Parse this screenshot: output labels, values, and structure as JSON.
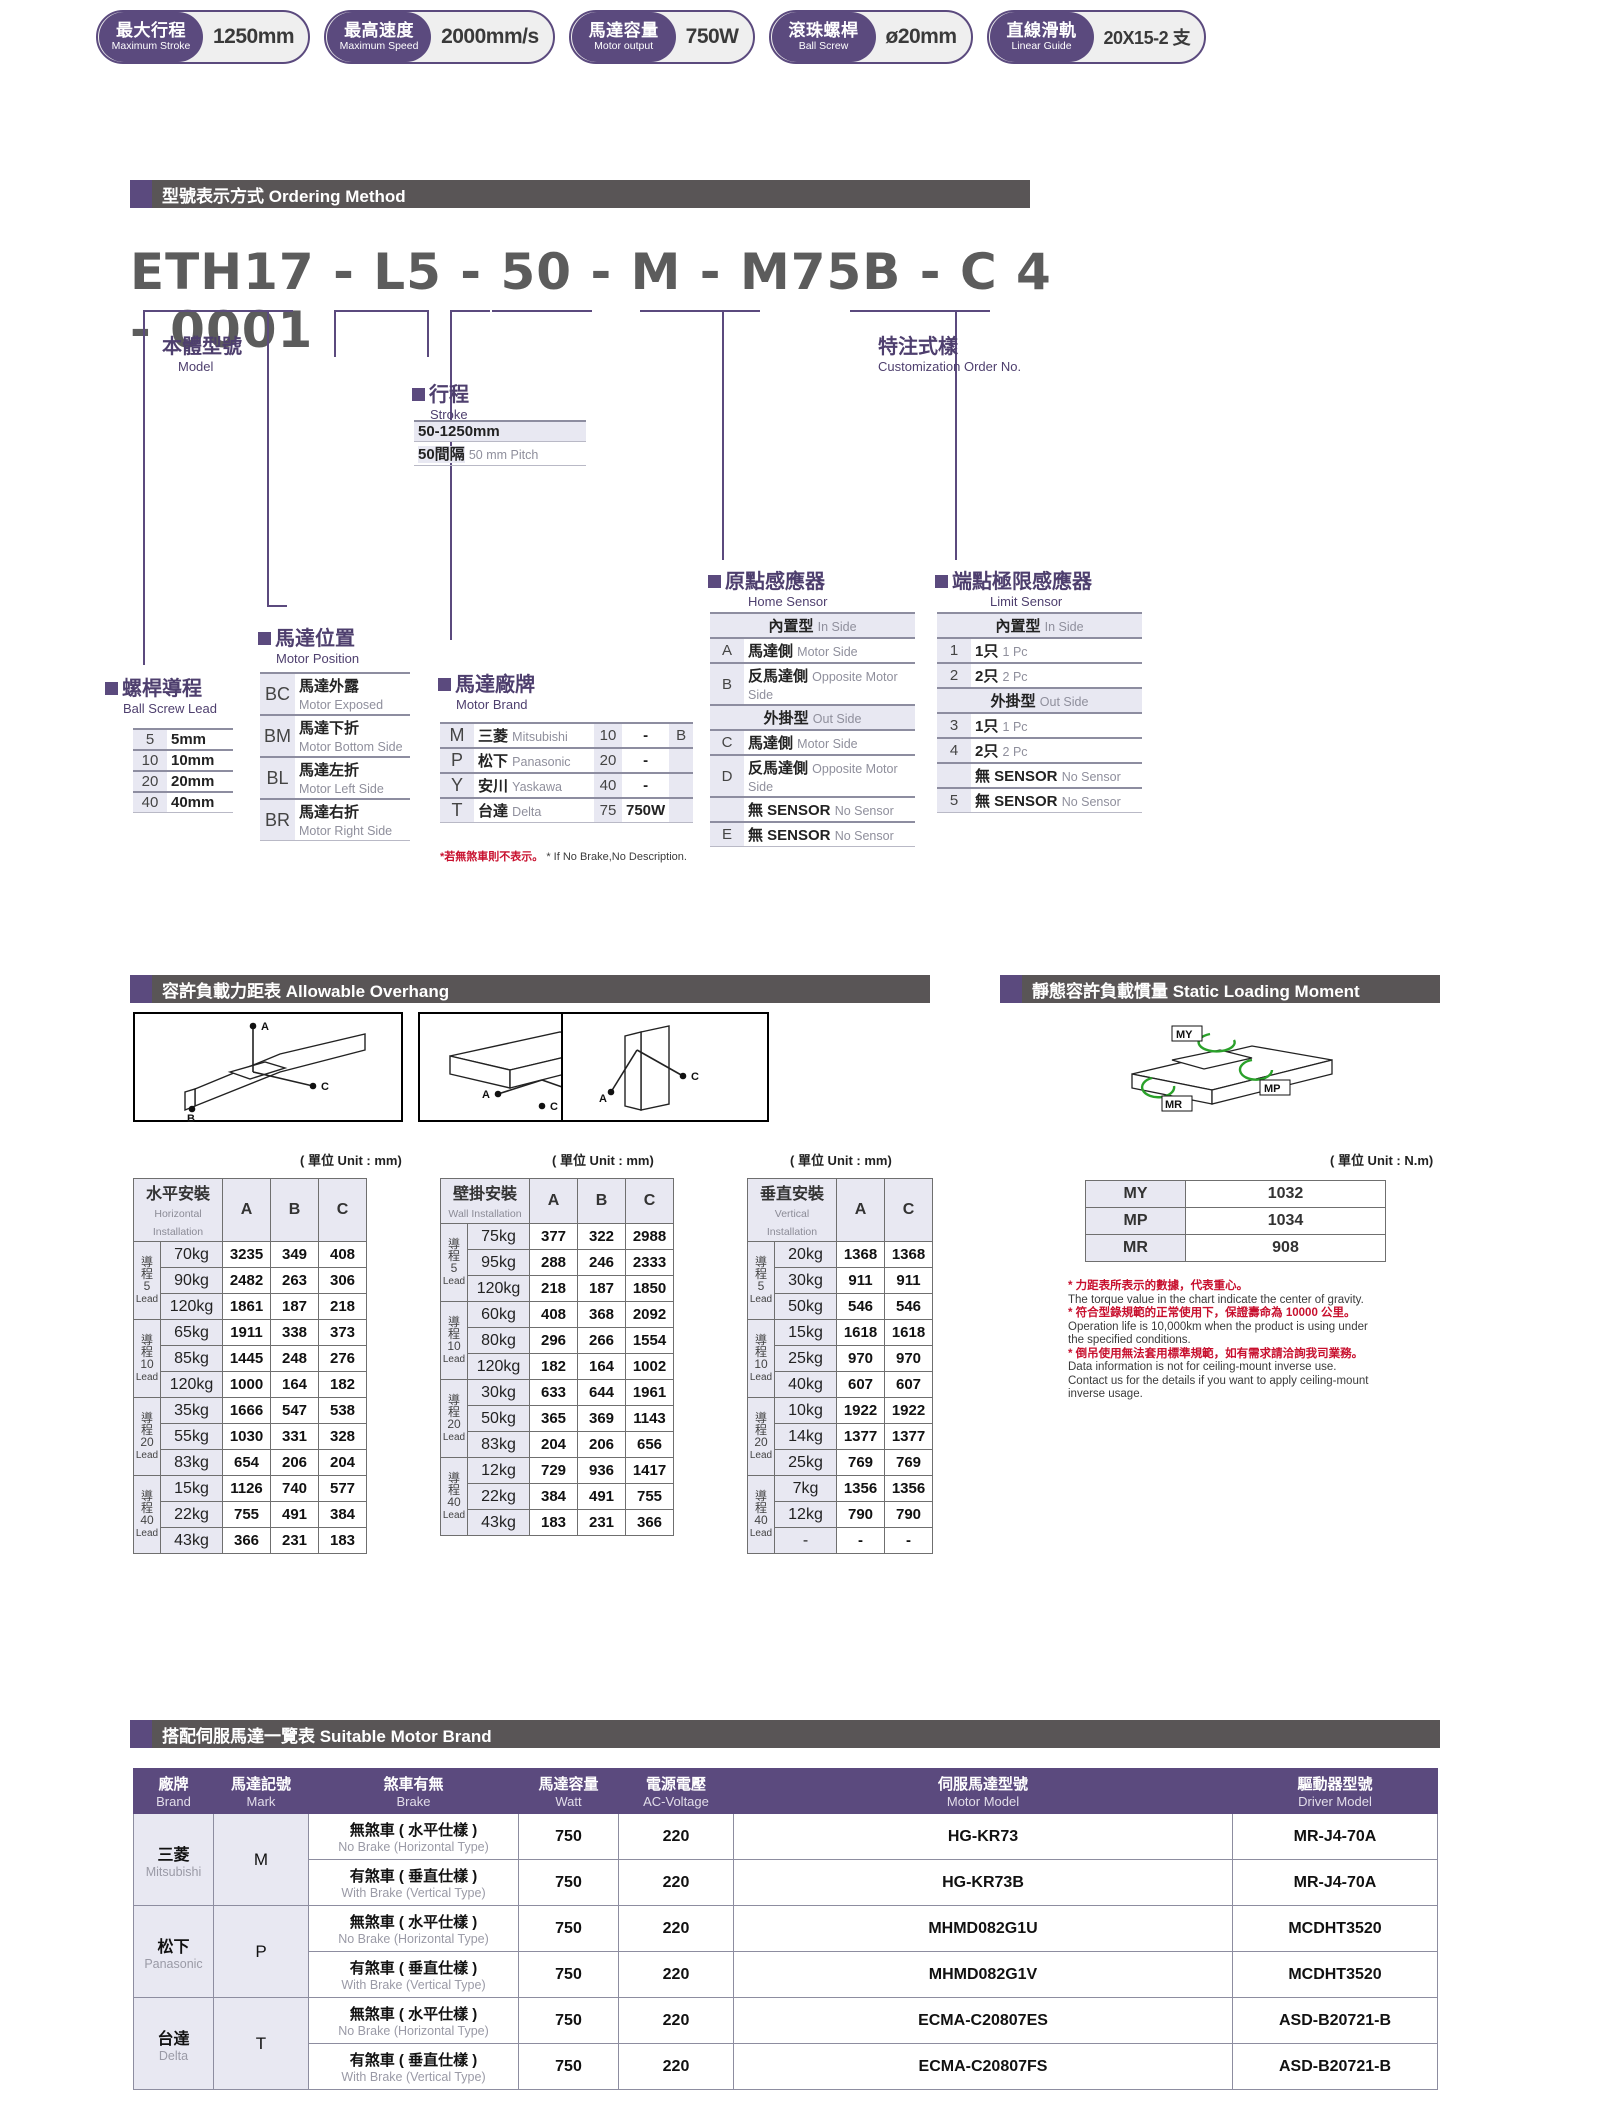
{
  "badges": [
    {
      "zh": "最大行程",
      "en": "Maximum Stroke",
      "value": "1250mm"
    },
    {
      "zh": "最高速度",
      "en": "Maximum Speed",
      "value": "2000mm/s"
    },
    {
      "zh": "馬達容量",
      "en": "Motor output",
      "value": "750W"
    },
    {
      "zh": "滾珠螺桿",
      "en": "Ball Screw",
      "value": "ø20mm"
    },
    {
      "zh": "直線滑軌",
      "en": "Linear Guide",
      "value": "20X15-2 支"
    }
  ],
  "sections": {
    "ordering": "型號表示方式 Ordering Method",
    "overhang": "容許負載力距表 Allowable Overhang",
    "static": "靜態容許負載慣量 Static Loading Moment",
    "motorbrand": "搭配伺服馬達一覽表 Suitable Motor Brand"
  },
  "ordering": {
    "model_string": "ETH17 - L5 - 50 - M - M75B - C 4 - 0001",
    "model_label": {
      "zh": "本體型號",
      "en": "Model"
    },
    "custom_label": {
      "zh": "特注式樣",
      "en": "Customization Order No."
    },
    "stroke": {
      "zh": "行程",
      "en": "Stroke",
      "range": "50-1250mm",
      "pitch_key": "50間隔",
      "pitch_val": "50 mm Pitch"
    },
    "lead": {
      "zh": "螺桿導程",
      "en": "Ball Screw Lead",
      "rows": [
        {
          "k": "5",
          "v": "5mm"
        },
        {
          "k": "10",
          "v": "10mm"
        },
        {
          "k": "20",
          "v": "20mm"
        },
        {
          "k": "40",
          "v": "40mm"
        }
      ]
    },
    "position": {
      "zh": "馬達位置",
      "en": "Motor Position",
      "rows": [
        {
          "k": "BC",
          "zh": "馬達外露",
          "en": "Motor Exposed"
        },
        {
          "k": "BM",
          "zh": "馬達下折",
          "en": "Motor Bottom Side"
        },
        {
          "k": "BL",
          "zh": "馬達左折",
          "en": "Motor Left Side"
        },
        {
          "k": "BR",
          "zh": "馬達右折",
          "en": "Motor Right Side"
        }
      ]
    },
    "brand": {
      "zh": "馬達廠牌",
      "en": "Motor Brand",
      "rows": [
        {
          "k": "M",
          "zh": "三菱",
          "en": "Mitsubishi",
          "num": "10",
          "dash": "-",
          "b": "B"
        },
        {
          "k": "P",
          "zh": "松下",
          "en": "Panasonic",
          "num": "20",
          "dash": "-",
          "b": ""
        },
        {
          "k": "Y",
          "zh": "安川",
          "en": "Yaskawa",
          "num": "40",
          "dash": "-",
          "b": ""
        },
        {
          "k": "T",
          "zh": "台達",
          "en": "Delta",
          "num": "75",
          "dash": "750W",
          "b": ""
        }
      ],
      "note_zh": "*若無煞車則不表示。",
      "note_en": "* If No Brake,No Description."
    },
    "home_sensor": {
      "zh": "原點感應器",
      "en": "Home Sensor",
      "group_in": "內置型",
      "group_in_en": "In Side",
      "group_out": "外掛型",
      "group_out_en": "Out Side",
      "rows": [
        {
          "k": "A",
          "zh": "馬達側",
          "en": "Motor Side"
        },
        {
          "k": "B",
          "zh": "反馬達側",
          "en": "Opposite Motor Side"
        },
        {
          "k": "C",
          "zh": "馬達側",
          "en": "Motor Side"
        },
        {
          "k": "D",
          "zh": "反馬達側",
          "en": "Opposite Motor Side"
        },
        {
          "k": "",
          "zh": "無 SENSOR",
          "en": "No Sensor"
        },
        {
          "k": "E",
          "zh": "無 SENSOR",
          "en": "No Sensor"
        }
      ]
    },
    "limit_sensor": {
      "zh": "端點極限感應器",
      "en": "Limit Sensor",
      "group_in": "內置型",
      "group_in_en": "In Side",
      "group_out": "外掛型",
      "group_out_en": "Out Side",
      "rows": [
        {
          "k": "1",
          "zh": "1只",
          "en": "1 Pc"
        },
        {
          "k": "2",
          "zh": "2只",
          "en": "2 Pc"
        },
        {
          "k": "3",
          "zh": "1只",
          "en": "1 Pc"
        },
        {
          "k": "4",
          "zh": "2只",
          "en": "2 Pc"
        },
        {
          "k": "",
          "zh": "無 SENSOR",
          "en": "No Sensor"
        },
        {
          "k": "5",
          "zh": "無 SENSOR",
          "en": "No Sensor"
        }
      ]
    }
  },
  "overhang": {
    "unit_label": "( 單位 Unit : mm)",
    "tables": [
      {
        "head_zh": "水平安裝",
        "head_en": "Horizontal Installation",
        "cols": [
          "A",
          "B",
          "C"
        ],
        "groups": [
          {
            "lead": "導程 5 Lead",
            "rows": [
              {
                "kg": "70kg",
                "vals": [
                  "3235",
                  "349",
                  "408"
                ]
              },
              {
                "kg": "90kg",
                "vals": [
                  "2482",
                  "263",
                  "306"
                ]
              },
              {
                "kg": "120kg",
                "vals": [
                  "1861",
                  "187",
                  "218"
                ]
              }
            ]
          },
          {
            "lead": "導程 10 Lead",
            "rows": [
              {
                "kg": "65kg",
                "vals": [
                  "1911",
                  "338",
                  "373"
                ]
              },
              {
                "kg": "85kg",
                "vals": [
                  "1445",
                  "248",
                  "276"
                ]
              },
              {
                "kg": "120kg",
                "vals": [
                  "1000",
                  "164",
                  "182"
                ]
              }
            ]
          },
          {
            "lead": "導程 20 Lead",
            "rows": [
              {
                "kg": "35kg",
                "vals": [
                  "1666",
                  "547",
                  "538"
                ]
              },
              {
                "kg": "55kg",
                "vals": [
                  "1030",
                  "331",
                  "328"
                ]
              },
              {
                "kg": "83kg",
                "vals": [
                  "654",
                  "206",
                  "204"
                ]
              }
            ]
          },
          {
            "lead": "導程 40 Lead",
            "rows": [
              {
                "kg": "15kg",
                "vals": [
                  "1126",
                  "740",
                  "577"
                ]
              },
              {
                "kg": "22kg",
                "vals": [
                  "755",
                  "491",
                  "384"
                ]
              },
              {
                "kg": "43kg",
                "vals": [
                  "366",
                  "231",
                  "183"
                ]
              }
            ]
          }
        ]
      },
      {
        "head_zh": "壁掛安裝",
        "head_en": "Wall Installation",
        "cols": [
          "A",
          "B",
          "C"
        ],
        "groups": [
          {
            "lead": "導程 5 Lead",
            "rows": [
              {
                "kg": "75kg",
                "vals": [
                  "377",
                  "322",
                  "2988"
                ]
              },
              {
                "kg": "95kg",
                "vals": [
                  "288",
                  "246",
                  "2333"
                ]
              },
              {
                "kg": "120kg",
                "vals": [
                  "218",
                  "187",
                  "1850"
                ]
              }
            ]
          },
          {
            "lead": "導程 10 Lead",
            "rows": [
              {
                "kg": "60kg",
                "vals": [
                  "408",
                  "368",
                  "2092"
                ]
              },
              {
                "kg": "80kg",
                "vals": [
                  "296",
                  "266",
                  "1554"
                ]
              },
              {
                "kg": "120kg",
                "vals": [
                  "182",
                  "164",
                  "1002"
                ]
              }
            ]
          },
          {
            "lead": "導程 20 Lead",
            "rows": [
              {
                "kg": "30kg",
                "vals": [
                  "633",
                  "644",
                  "1961"
                ]
              },
              {
                "kg": "50kg",
                "vals": [
                  "365",
                  "369",
                  "1143"
                ]
              },
              {
                "kg": "83kg",
                "vals": [
                  "204",
                  "206",
                  "656"
                ]
              }
            ]
          },
          {
            "lead": "導程 40 Lead",
            "rows": [
              {
                "kg": "12kg",
                "vals": [
                  "729",
                  "936",
                  "1417"
                ]
              },
              {
                "kg": "22kg",
                "vals": [
                  "384",
                  "491",
                  "755"
                ]
              },
              {
                "kg": "43kg",
                "vals": [
                  "183",
                  "231",
                  "366"
                ]
              }
            ]
          }
        ]
      },
      {
        "head_zh": "垂直安裝",
        "head_en": "Vertical Installation",
        "cols": [
          "A",
          "C"
        ],
        "groups": [
          {
            "lead": "導程 5 Lead",
            "rows": [
              {
                "kg": "20kg",
                "vals": [
                  "1368",
                  "1368"
                ]
              },
              {
                "kg": "30kg",
                "vals": [
                  "911",
                  "911"
                ]
              },
              {
                "kg": "50kg",
                "vals": [
                  "546",
                  "546"
                ]
              }
            ]
          },
          {
            "lead": "導程 10 Lead",
            "rows": [
              {
                "kg": "15kg",
                "vals": [
                  "1618",
                  "1618"
                ]
              },
              {
                "kg": "25kg",
                "vals": [
                  "970",
                  "970"
                ]
              },
              {
                "kg": "40kg",
                "vals": [
                  "607",
                  "607"
                ]
              }
            ]
          },
          {
            "lead": "導程 20 Lead",
            "rows": [
              {
                "kg": "10kg",
                "vals": [
                  "1922",
                  "1922"
                ]
              },
              {
                "kg": "14kg",
                "vals": [
                  "1377",
                  "1377"
                ]
              },
              {
                "kg": "25kg",
                "vals": [
                  "769",
                  "769"
                ]
              }
            ]
          },
          {
            "lead": "導程 40 Lead",
            "rows": [
              {
                "kg": "7kg",
                "vals": [
                  "1356",
                  "1356"
                ]
              },
              {
                "kg": "12kg",
                "vals": [
                  "790",
                  "790"
                ]
              },
              {
                "kg": "-",
                "vals": [
                  "-",
                  "-"
                ]
              }
            ]
          }
        ]
      }
    ]
  },
  "static_loading": {
    "unit_label": "( 單位 Unit : N.m)",
    "rows": [
      {
        "k": "MY",
        "v": "1032"
      },
      {
        "k": "MP",
        "v": "1034"
      },
      {
        "k": "MR",
        "v": "908"
      }
    ],
    "diagram_labels": [
      "MY",
      "MP",
      "MR"
    ],
    "notes": [
      {
        "zh": "* 力距表所表示的數據，代表重心。",
        "en": "The torque value in the chart indicate the center of gravity."
      },
      {
        "zh": "* 符合型錄規範的正常使用下，保證壽命為 10000 公里。",
        "en": "Operation life is 10,000km when the product is using under the specified conditions."
      },
      {
        "zh": "* 倒吊使用無法套用標準規範，如有需求請洽詢我司業務。",
        "en": "Data information is not for ceiling-mount inverse use. Contact us for the details if you want to apply ceiling-mount inverse usage."
      }
    ]
  },
  "motor_brand_table": {
    "headers": [
      {
        "zh": "廠牌",
        "en": "Brand"
      },
      {
        "zh": "馬達記號",
        "en": "Mark"
      },
      {
        "zh": "煞車有無",
        "en": "Brake"
      },
      {
        "zh": "馬達容量",
        "en": "Watt"
      },
      {
        "zh": "電源電壓",
        "en": "AC-Voltage"
      },
      {
        "zh": "伺服馬達型號",
        "en": "Motor Model"
      },
      {
        "zh": "驅動器型號",
        "en": "Driver Model"
      }
    ],
    "groups": [
      {
        "brand_zh": "三菱",
        "brand_en": "Mitsubishi",
        "mark": "M",
        "rows": [
          {
            "brake_zh": "無煞車 ( 水平仕樣 )",
            "brake_en": "No Brake (Horizontal Type)",
            "watt": "750",
            "volt": "220",
            "motor": "HG-KR73",
            "driver": "MR-J4-70A"
          },
          {
            "brake_zh": "有煞車 ( 垂直仕樣 )",
            "brake_en": "With Brake (Vertical Type)",
            "watt": "750",
            "volt": "220",
            "motor": "HG-KR73B",
            "driver": "MR-J4-70A"
          }
        ]
      },
      {
        "brand_zh": "松下",
        "brand_en": "Panasonic",
        "mark": "P",
        "rows": [
          {
            "brake_zh": "無煞車 ( 水平仕樣 )",
            "brake_en": "No Brake (Horizontal Type)",
            "watt": "750",
            "volt": "220",
            "motor": "MHMD082G1U",
            "driver": "MCDHT3520"
          },
          {
            "brake_zh": "有煞車 ( 垂直仕樣 )",
            "brake_en": "With Brake (Vertical Type)",
            "watt": "750",
            "volt": "220",
            "motor": "MHMD082G1V",
            "driver": "MCDHT3520"
          }
        ]
      },
      {
        "brand_zh": "台達",
        "brand_en": "Delta",
        "mark": "T",
        "rows": [
          {
            "brake_zh": "無煞車 ( 水平仕樣 )",
            "brake_en": "No Brake (Horizontal Type)",
            "watt": "750",
            "volt": "220",
            "motor": "ECMA-C20807ES",
            "driver": "ASD-B20721-B"
          },
          {
            "brake_zh": "有煞車 ( 垂直仕樣 )",
            "brake_en": "With Brake (Vertical Type)",
            "watt": "750",
            "volt": "220",
            "motor": "ECMA-C20807FS",
            "driver": "ASD-B20721-B"
          }
        ]
      }
    ]
  },
  "colors": {
    "purple": "#5b4a7e",
    "bar_gray": "#595556",
    "cell_tint": "#e8e8f2",
    "red": "#c8102e"
  }
}
